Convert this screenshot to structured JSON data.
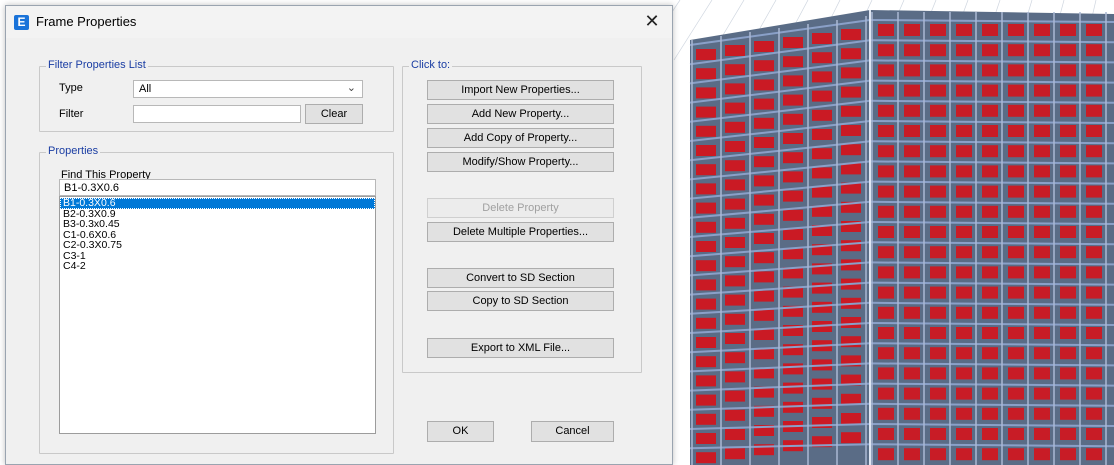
{
  "dialog": {
    "title": "Frame Properties",
    "app_icon_letter": "E",
    "close_glyph": "✕"
  },
  "filter": {
    "group_label": "Filter Properties List",
    "type_label": "Type",
    "type_value": "All",
    "filter_label": "Filter",
    "filter_value": "",
    "clear_label": "Clear"
  },
  "properties": {
    "group_label": "Properties",
    "find_label": "Find This Property",
    "find_value": "B1-0.3X0.6",
    "items": [
      "B1-0.3X0.6",
      "B2-0.3X0.9",
      "B3-0.3x0.45",
      "C1-0.6X0.6",
      "C2-0.3X0.75",
      "C3-1",
      "C4-2"
    ],
    "selected_index": 0
  },
  "click_to": {
    "group_label": "Click to:",
    "import_label": "Import New Properties...",
    "add_label": "Add New Property...",
    "add_copy_label": "Add Copy of Property...",
    "modify_label": "Modify/Show Property...",
    "delete_label": "Delete Property",
    "delete_multiple_label": "Delete Multiple Properties...",
    "convert_sd_label": "Convert to SD Section",
    "copy_sd_label": "Copy to SD Section",
    "export_xml_label": "Export to XML File..."
  },
  "footer": {
    "ok_label": "OK",
    "cancel_label": "Cancel"
  },
  "colors": {
    "accent": "#0078d7",
    "group_label": "#1a3da3",
    "model_red": "#d4141c",
    "model_frame": "#8aa0c8"
  }
}
